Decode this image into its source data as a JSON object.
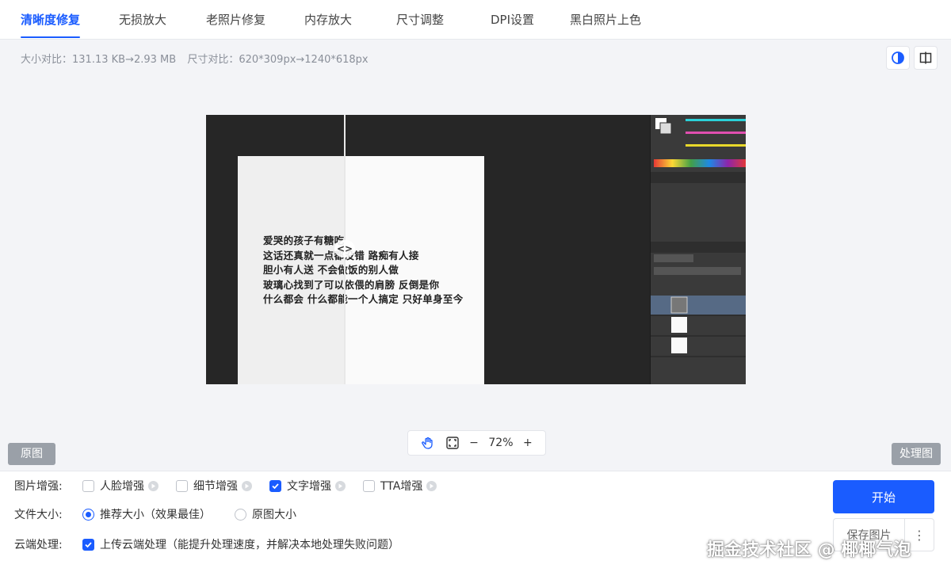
{
  "tabs": [
    {
      "label": "清晰度修复",
      "active": true
    },
    {
      "label": "无损放大"
    },
    {
      "label": "老照片修复"
    },
    {
      "label": "内存放大"
    },
    {
      "label": "尺寸调整"
    },
    {
      "label": "DPI设置"
    },
    {
      "label": "黑白照片上色"
    }
  ],
  "info": {
    "size_compare": "大小对比：131.13 KB→2.93 MB",
    "dimension_compare": "尺寸对比：620*309px→1240*618px"
  },
  "preview": {
    "poem_lines": [
      "爱哭的孩子有糖吃",
      "这话还真就一点都没错  路痴有人接",
      "胆小有人送  不会做饭的别人做",
      "玻璃心找到了可以依偎的肩膀  反倒是你",
      "什么都会  什么都能一个人搞定  只好单身至今"
    ],
    "handle": "<>"
  },
  "zoom": {
    "level": "72%",
    "minus": "−",
    "plus": "+"
  },
  "labels": {
    "original": "原图",
    "processed": "处理图"
  },
  "options": {
    "enhance_label": "图片增强:",
    "enhance_items": [
      {
        "label": "人脸增强",
        "checked": false
      },
      {
        "label": "细节增强",
        "checked": false
      },
      {
        "label": "文字增强",
        "checked": true
      },
      {
        "label": "TTA增强",
        "checked": false
      }
    ],
    "filesize_label": "文件大小:",
    "filesize_items": [
      {
        "label": "推荐大小（效果最佳）",
        "selected": true
      },
      {
        "label": "原图大小",
        "selected": false
      }
    ],
    "cloud_label": "云端处理:",
    "cloud_item": {
      "label": "上传云端处理（能提升处理速度，并解决本地处理失败问题）",
      "checked": true
    }
  },
  "actions": {
    "start": "开始",
    "save": "保存图片",
    "more": "⋮"
  },
  "watermark": "掘金技术社区 @ 椰椰气泡",
  "colors": {
    "accent": "#1a5cff"
  }
}
